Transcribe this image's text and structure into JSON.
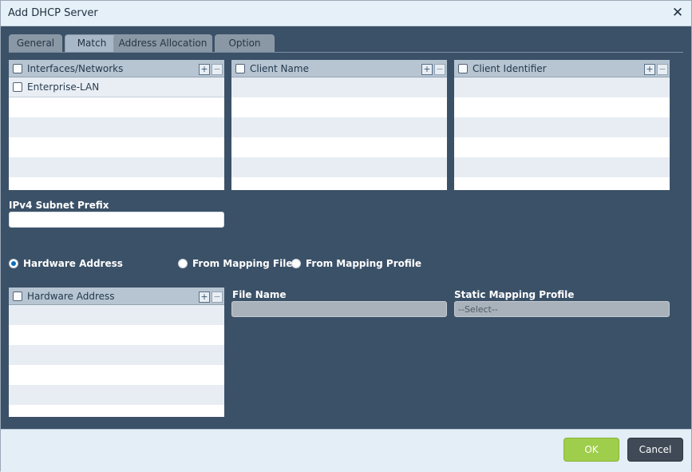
{
  "dialog": {
    "title": "Add DHCP Server",
    "close_icon": "close-icon"
  },
  "tabs": [
    {
      "label": "General"
    },
    {
      "label": "Match"
    },
    {
      "label": "Address Allocation"
    },
    {
      "label": "Option"
    }
  ],
  "grids": {
    "interfaces": {
      "header": "Interfaces/Networks",
      "rows": [
        {
          "label": "Enterprise-LAN"
        }
      ]
    },
    "client_name": {
      "header": "Client Name"
    },
    "client_identifier": {
      "header": "Client Identifier"
    },
    "hardware_address": {
      "header": "Hardware Address"
    }
  },
  "fields": {
    "ipv4_subnet_prefix_label": "IPv4 Subnet Prefix",
    "ipv4_subnet_prefix_value": "",
    "file_name_label": "File Name",
    "file_name_value": "",
    "static_mapping_profile_label": "Static Mapping Profile",
    "static_mapping_profile_value": "--Select--"
  },
  "radios": {
    "hardware_address": "Hardware Address",
    "from_mapping_file": "From Mapping File",
    "from_mapping_profile": "From Mapping Profile",
    "selected": "hardware_address"
  },
  "buttons": {
    "ok": "OK",
    "cancel": "Cancel"
  },
  "colors": {
    "panel": "#3b5168",
    "accent_ok": "#9fce4c",
    "radio_selected": "#0b6ebd"
  }
}
